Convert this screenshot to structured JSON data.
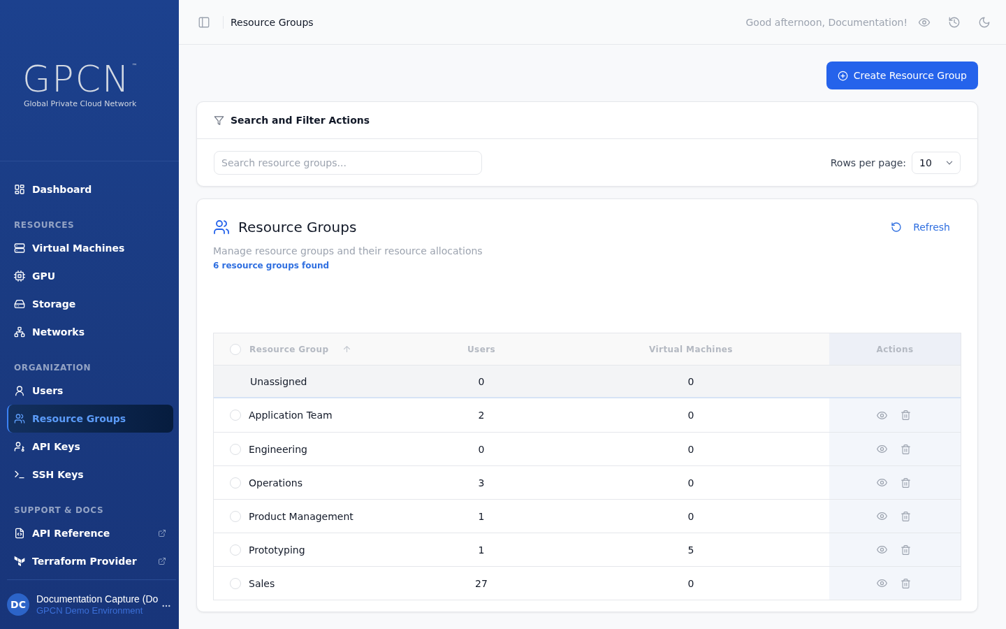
{
  "sidebar": {
    "logo": {
      "wordmark": "GPCN",
      "trademark": "™",
      "tagline": "Global Private Cloud Network"
    },
    "sections": [
      {
        "items": [
          {
            "label": "Dashboard",
            "selected": false,
            "external": false
          }
        ]
      },
      {
        "heading": "RESOURCES",
        "items": [
          {
            "label": "Virtual Machines",
            "selected": false,
            "external": false
          },
          {
            "label": "GPU",
            "selected": false,
            "external": false
          },
          {
            "label": "Storage",
            "selected": false,
            "external": false
          },
          {
            "label": "Networks",
            "selected": false,
            "external": false
          }
        ]
      },
      {
        "heading": "ORGANIZATION",
        "items": [
          {
            "label": "Users",
            "selected": false,
            "external": false
          },
          {
            "label": "Resource Groups",
            "selected": true,
            "external": false
          },
          {
            "label": "API Keys",
            "selected": false,
            "external": false
          },
          {
            "label": "SSH Keys",
            "selected": false,
            "external": false
          }
        ]
      },
      {
        "heading": "SUPPORT & DOCS",
        "items": [
          {
            "label": "API Reference",
            "selected": false,
            "external": true
          },
          {
            "label": "Terraform Provider",
            "selected": false,
            "external": true
          }
        ]
      }
    ],
    "user": {
      "initials": "DC",
      "name": "Documentation Capture (Do",
      "environment": "GPCN Demo Environment"
    }
  },
  "header": {
    "title": "Resource Groups",
    "greeting": "Good afternoon, Documentation!"
  },
  "create_button": {
    "label": "Create Resource Group"
  },
  "filter_panel": {
    "title": "Search and Filter Actions",
    "search": {
      "placeholder": "Search resource groups..."
    },
    "rows_per_page": {
      "label": "Rows per page:",
      "value": "10"
    }
  },
  "groups_panel": {
    "title": "Resource Groups",
    "refresh": "Refresh",
    "description": "Manage resource groups and their resource allocations",
    "count": "6 resource groups found",
    "table": {
      "all_selected": false,
      "columns": [
        {
          "label": "Resource Group",
          "kind": "name",
          "sorted": true
        },
        {
          "label": "Users",
          "kind": "count"
        },
        {
          "label": "Virtual Machines",
          "kind": "count"
        },
        {
          "label": "Actions",
          "kind": "actions"
        }
      ],
      "rows": [
        {
          "kind": "unassigned",
          "name": "Unassigned",
          "users": "0",
          "virtual_machines": "0"
        },
        {
          "kind": "group",
          "name": "Application Team",
          "users": "2",
          "virtual_machines": "0",
          "selected": false
        },
        {
          "kind": "group",
          "name": "Engineering",
          "users": "0",
          "virtual_machines": "0",
          "selected": false
        },
        {
          "kind": "group",
          "name": "Operations",
          "users": "3",
          "virtual_machines": "0",
          "selected": false
        },
        {
          "kind": "group",
          "name": "Product Management",
          "users": "1",
          "virtual_machines": "0",
          "selected": false
        },
        {
          "kind": "group",
          "name": "Prototyping",
          "users": "1",
          "virtual_machines": "5",
          "selected": false
        },
        {
          "kind": "group",
          "name": "Sales",
          "users": "27",
          "virtual_machines": "0",
          "selected": false
        }
      ]
    }
  }
}
